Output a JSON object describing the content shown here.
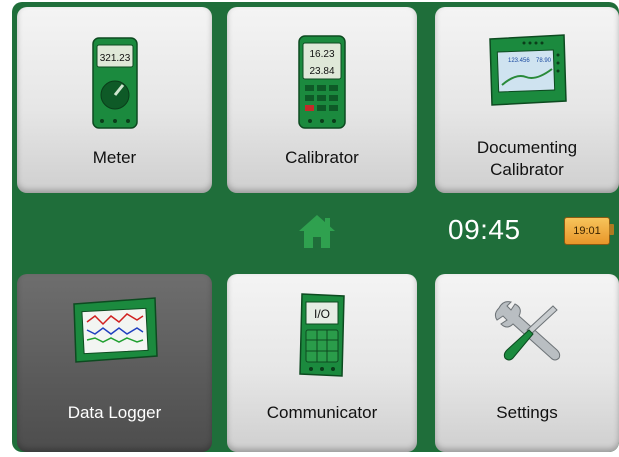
{
  "tiles": {
    "meter": {
      "label": "Meter",
      "icon": "meter-device-icon",
      "display": "321.23"
    },
    "calibrator": {
      "label": "Calibrator",
      "icon": "calibrator-device-icon",
      "display1": "16.23",
      "display2": "23.84"
    },
    "documenting_calibrator": {
      "label": "Documenting\nCalibrator",
      "icon": "documenting-calibrator-icon",
      "display1": "123.456",
      "display2": "78.90"
    },
    "data_logger": {
      "label": "Data Logger",
      "icon": "data-logger-icon",
      "selected": true
    },
    "communicator": {
      "label": "Communicator",
      "icon": "communicator-device-icon",
      "display": "I/O"
    },
    "settings": {
      "label": "Settings",
      "icon": "wrench-screwdriver-icon"
    }
  },
  "status_bar": {
    "home_icon": "home-icon",
    "time": "09:45",
    "battery_label": "19:01"
  },
  "colors": {
    "background_green": "#1f6e3a",
    "device_green": "#1b8a3e",
    "battery_orange": "#eaa43a",
    "selected_tile": "#5a5a5a"
  }
}
